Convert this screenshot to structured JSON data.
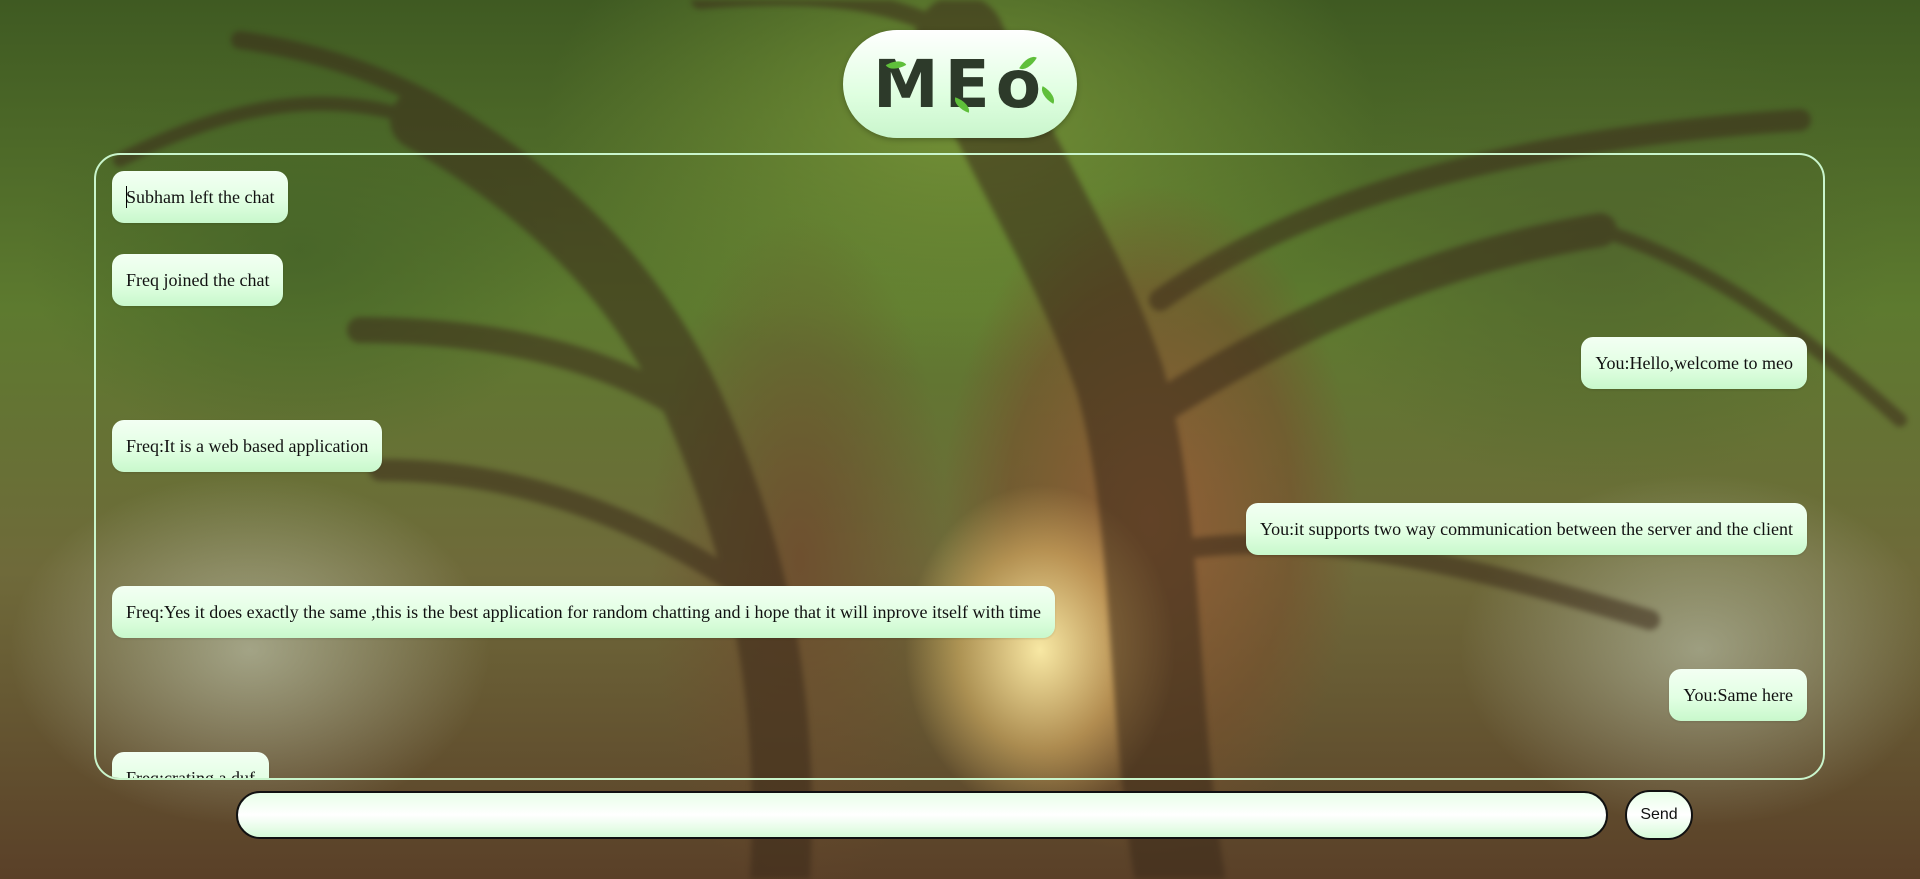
{
  "app": {
    "logo_text": "MEo"
  },
  "colors": {
    "bubble_light": "#f3fff3",
    "bubble_dark": "#c8f8cc",
    "border_accent": "#c9f5cc",
    "text": "#111111"
  },
  "messages": [
    {
      "side": "left",
      "text": "Subham left the chat"
    },
    {
      "side": "left",
      "text": "Freq joined the chat"
    },
    {
      "side": "right",
      "text": "You:Hello,welcome to meo"
    },
    {
      "side": "left",
      "text": "Freq:It is a web based application"
    },
    {
      "side": "right",
      "text": "You:it supports two way communication between the server and the client"
    },
    {
      "side": "left",
      "text": "Freq:Yes it does exactly the same ,this is the best application for random chatting and i hope that it will inprove itself with time"
    },
    {
      "side": "right",
      "text": "You:Same here"
    },
    {
      "side": "left",
      "text": "Freq:crating a duf"
    }
  ],
  "composer": {
    "value": "",
    "placeholder": "",
    "send_label": "Send"
  }
}
